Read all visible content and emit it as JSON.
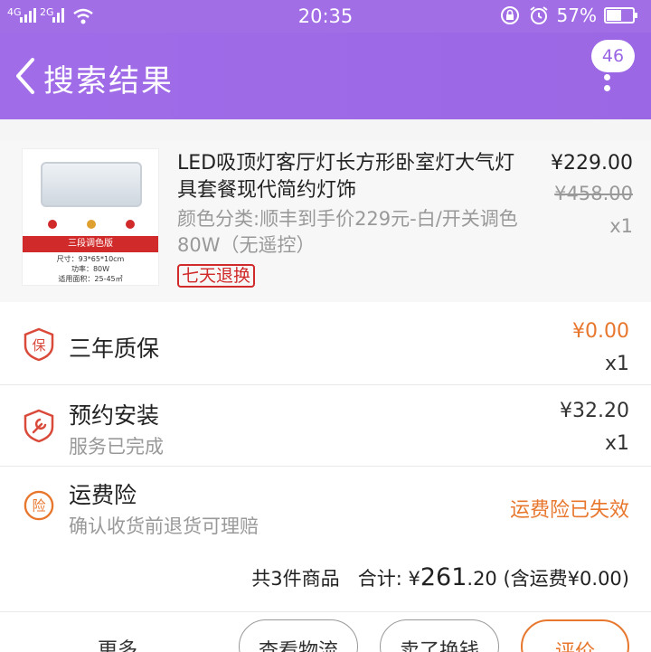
{
  "status_bar": {
    "network_1": "4G",
    "network_2": "2G",
    "time": "20:35",
    "battery": "57%",
    "battery_level": 0.57
  },
  "nav": {
    "title": "搜索结果",
    "badge_count": "46"
  },
  "product": {
    "title": "LED吸顶灯客厅灯长方形卧室灯大气灯具套餐现代简约灯饰",
    "sku": "颜色分类:顺丰到手价229元-白/开关调色80W（无遥控）",
    "tag": "七天退换",
    "price": "¥229.00",
    "original_price": "¥458.00",
    "qty": "x1",
    "image": {
      "banner": "三段调色版",
      "spec_size": "尺寸：93*65*10cm",
      "spec_power": "功率：80W",
      "spec_area": "适用面积：25-45㎡"
    }
  },
  "services": [
    {
      "icon": "warranty-icon",
      "label": "三年质保",
      "value": "¥0.00",
      "qty": "x1"
    },
    {
      "icon": "install-icon",
      "label": "预约安装",
      "sub": "服务已完成",
      "value": "¥32.20",
      "qty": "x1"
    },
    {
      "icon": "insurance-icon",
      "label": "运费险",
      "sub": "确认收货前退货可理赔",
      "value": "运费险已失效"
    }
  ],
  "icon_glyphs": {
    "warranty": "保",
    "insurance": "险"
  },
  "summary": {
    "count_text": "共3件商品",
    "total_label": "合计:",
    "currency": "¥",
    "total_int": "261",
    "total_dec": ".20",
    "shipping_note": "(含运费¥0.00)"
  },
  "actions": {
    "more": "更多",
    "logistics": "查看物流",
    "sell": "卖了换钱",
    "review": "评价"
  },
  "colors": {
    "accent": "#a26ee6",
    "orange": "#e8772e",
    "red": "#d12a2a"
  }
}
